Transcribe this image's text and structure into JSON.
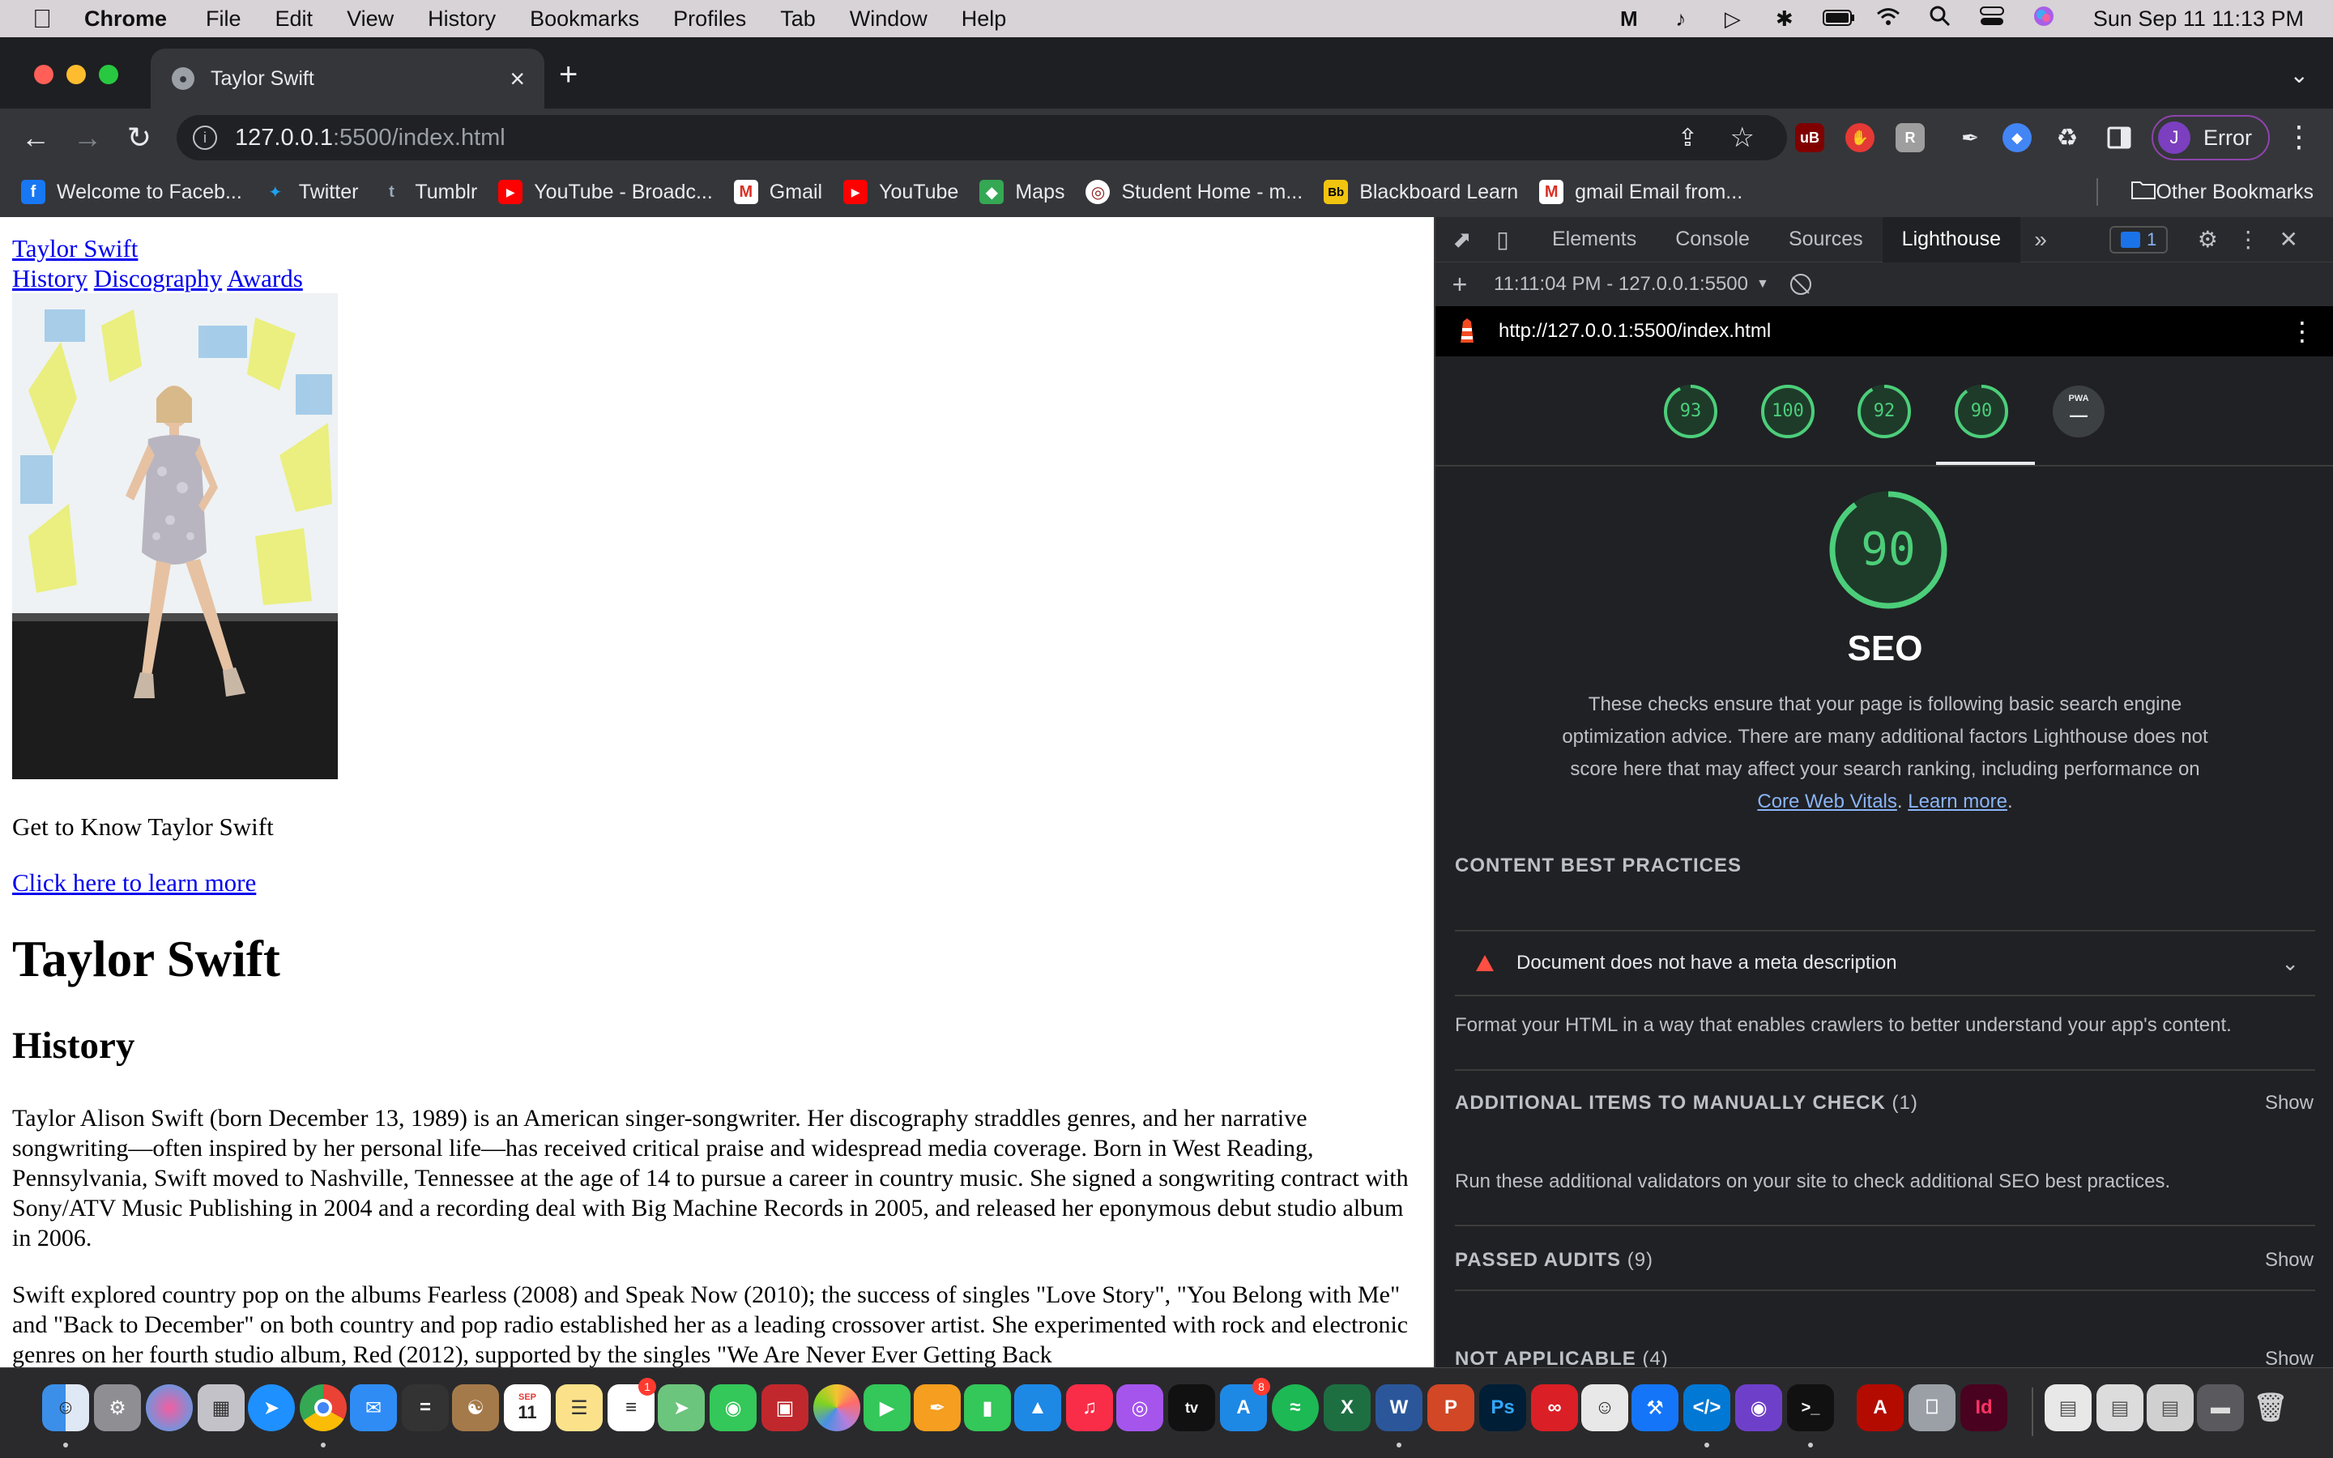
{
  "menubar": {
    "app_name": "Chrome",
    "items": [
      "File",
      "Edit",
      "View",
      "History",
      "Bookmarks",
      "Profiles",
      "Tab",
      "Window",
      "Help"
    ],
    "clock": "Sun Sep 11  11:13 PM"
  },
  "browser": {
    "tab_title": "Taylor Swift",
    "url_host": "127.0.0.1",
    "url_path": ":5500/index.html",
    "profile_initial": "J",
    "profile_label": "Error"
  },
  "bookmarks": {
    "items": [
      {
        "label": "Welcome to Faceb...",
        "icon": "facebook-icon",
        "color": "#1877f2",
        "glyph": "f"
      },
      {
        "label": "Twitter",
        "icon": "twitter-icon",
        "color": "#1da1f2",
        "glyph": "t"
      },
      {
        "label": "Tumblr",
        "icon": "tumblr-icon",
        "color": "#36465d",
        "glyph": "t"
      },
      {
        "label": "YouTube - Broadc...",
        "icon": "youtube-icon",
        "color": "#ff0000",
        "glyph": "▶"
      },
      {
        "label": "Gmail",
        "icon": "gmail-icon",
        "color": "#d93025",
        "glyph": "M"
      },
      {
        "label": "YouTube",
        "icon": "youtube-icon",
        "color": "#ff0000",
        "glyph": "▶"
      },
      {
        "label": "Maps",
        "icon": "maps-icon",
        "color": "#34a853",
        "glyph": "◆"
      },
      {
        "label": "Student Home - m...",
        "icon": "student-home-icon",
        "color": "#8b1a1a",
        "glyph": "◎"
      },
      {
        "label": "Blackboard Learn",
        "icon": "blackboard-icon",
        "color": "#222222",
        "glyph": "Bb"
      },
      {
        "label": "gmail Email from...",
        "icon": "gmail-icon",
        "color": "#d93025",
        "glyph": "M"
      }
    ],
    "other": "Other Bookmarks"
  },
  "page": {
    "site_title": "Taylor Swift",
    "nav": [
      "History",
      "Discography",
      "Awards"
    ],
    "tagline": "Get to Know Taylor Swift",
    "learn_more": "Click here to learn more",
    "h1": "Taylor Swift",
    "h2": "History",
    "para1": "Taylor Alison Swift (born December 13, 1989) is an American singer-songwriter. Her discography straddles genres, and her narrative songwriting—often inspired by her personal life—has received critical praise and widespread media coverage. Born in West Reading, Pennsylvania, Swift moved to Nashville, Tennessee at the age of 14 to pursue a career in country music. She signed a songwriting contract with Sony/ATV Music Publishing in 2004 and a recording deal with Big Machine Records in 2005, and released her eponymous debut studio album in 2006.",
    "para2": "Swift explored country pop on the albums Fearless (2008) and Speak Now (2010); the success of singles \"Love Story\", \"You Belong with Me\" and \"Back to December\" on both country and pop radio established her as a leading crossover artist. She experimented with rock and electronic genres on her fourth studio album, Red (2012), supported by the singles \"We Are Never Ever Getting Back"
  },
  "devtools": {
    "tabs": [
      "Elements",
      "Console",
      "Sources",
      "Lighthouse"
    ],
    "active_tab": "Lighthouse",
    "issues_count": "1",
    "report_label": "11:11:04 PM - 127.0.0.1:5500",
    "report_url": "http://127.0.0.1:5500/index.html",
    "scores": [
      93,
      100,
      92,
      90
    ],
    "pwa_label": "PWA",
    "pwa_value": "—",
    "selected_score": 90,
    "selected_category": "SEO",
    "description": "These checks ensure that your page is following basic search engine optimization advice. There are many additional factors Lighthouse does not score here that may affect your search ranking, including performance on",
    "link_vitals": "Core Web Vitals",
    "link_learn": "Learn more",
    "score_color": "#4cce7a",
    "sections": {
      "content_head": "CONTENT BEST PRACTICES",
      "audit_fail": "Document does not have a meta description",
      "content_text": "Format your HTML in a way that enables crawlers to better understand your app's content.",
      "manual_head": "ADDITIONAL ITEMS TO MANUALLY CHECK",
      "manual_count": "(1)",
      "manual_text": "Run these additional validators on your site to check additional SEO best practices.",
      "passed_head": "PASSED AUDITS",
      "passed_count": "(9)",
      "na_head": "NOT APPLICABLE",
      "na_count": "(4)",
      "show": "Show"
    }
  },
  "dock": {
    "calendar_month": "SEP",
    "calendar_day": "11",
    "badge_reminders": "1",
    "badge_appstore": "8"
  }
}
